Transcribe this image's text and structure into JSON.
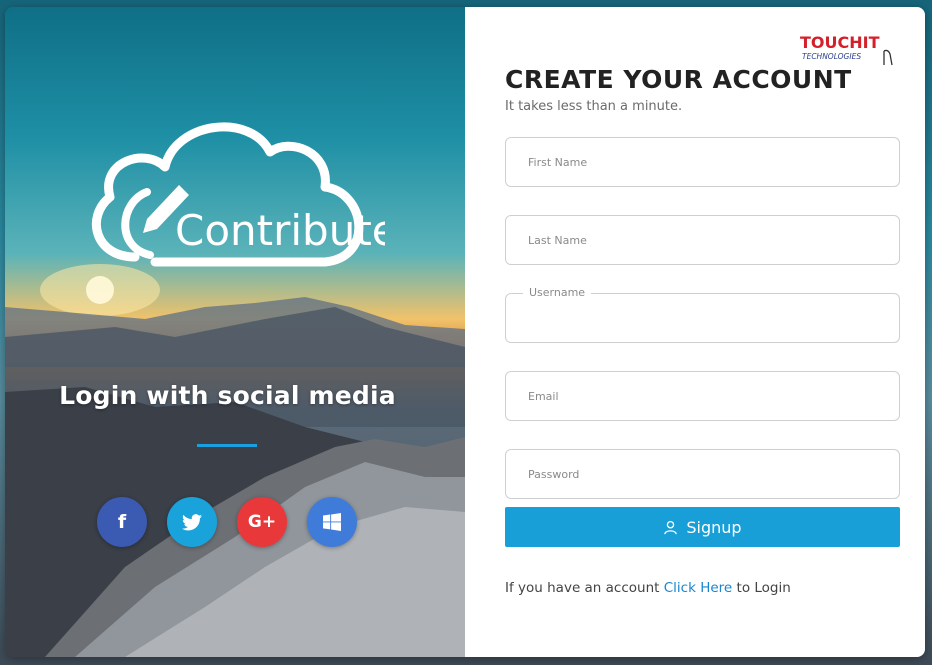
{
  "brand": {
    "app_name": "Contribute",
    "company_name": "TOUCHIT",
    "company_tagline": "TECHNOLOGIES"
  },
  "left": {
    "social_title": "Login with social media",
    "social_buttons": [
      {
        "name": "facebook",
        "glyph": "f",
        "color": "#3b5ab1"
      },
      {
        "name": "twitter",
        "icon": "twitter-bird-icon",
        "color": "#1aa3db"
      },
      {
        "name": "google-plus",
        "glyph": "G+",
        "color": "#e9383a"
      },
      {
        "name": "windows",
        "icon": "windows-logo-icon",
        "color": "#3f7bd9"
      }
    ]
  },
  "form": {
    "title": "CREATE YOUR ACCOUNT",
    "subtitle": "It takes less than a minute.",
    "first_name_placeholder": "First Name",
    "last_name_placeholder": "Last Name",
    "username_label": "Username",
    "email_placeholder": "Email",
    "password_placeholder": "Password",
    "signup_label": "Signup",
    "signup_icon": "user-icon",
    "login_prefix": "If you have an account",
    "login_link": "Click Here",
    "login_suffix": "to Login"
  },
  "colors": {
    "accent": "#189fd8",
    "link": "#1a86d0",
    "brand_red": "#d4202a"
  }
}
